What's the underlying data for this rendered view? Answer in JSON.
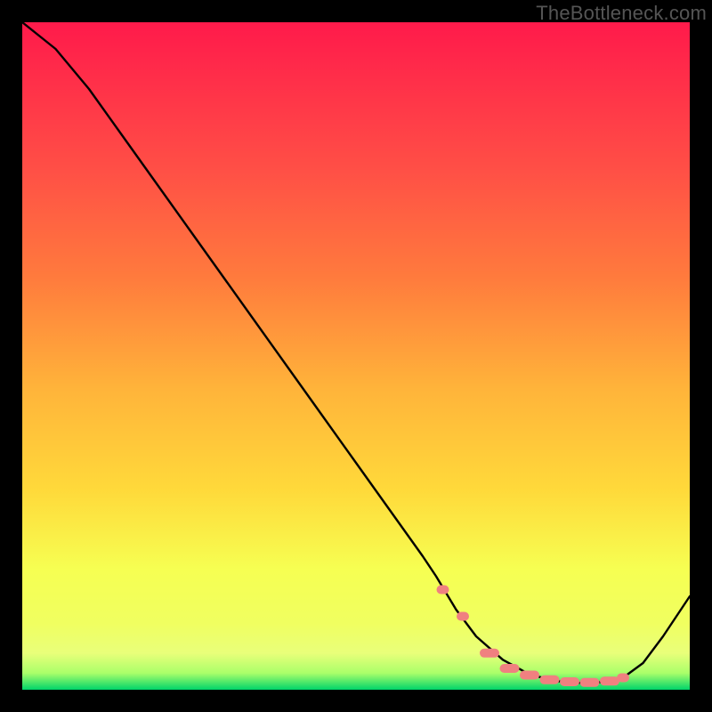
{
  "watermark": "TheBottleneck.com",
  "chart_data": {
    "type": "line",
    "title": "",
    "xlabel": "",
    "ylabel": "",
    "xlim": [
      0,
      100
    ],
    "ylim": [
      0,
      100
    ],
    "grid": false,
    "legend": false,
    "background_gradient": {
      "top": "#ff1a4b",
      "mid_upper": "#ff7a3d",
      "mid": "#ffd93a",
      "mid_lower": "#f6ff52",
      "optimal_band": "#e9ff7a",
      "bottom": "#00d46a"
    },
    "series": [
      {
        "name": "bottleneck-curve",
        "color": "#000000",
        "x": [
          0,
          5,
          10,
          15,
          20,
          25,
          30,
          35,
          40,
          45,
          50,
          55,
          60,
          62,
          65,
          68,
          72,
          76,
          80,
          84,
          88,
          90,
          93,
          96,
          100
        ],
        "y": [
          100,
          96,
          90,
          83,
          76,
          69,
          62,
          55,
          48,
          41,
          34,
          27,
          20,
          17,
          12,
          8,
          4.5,
          2.3,
          1.3,
          1.0,
          1.2,
          1.8,
          4,
          8,
          14
        ]
      }
    ],
    "markers": {
      "name": "highlight-dots",
      "color": "#f08080",
      "shape": "rounded",
      "x": [
        63,
        66,
        70,
        73,
        76,
        79,
        82,
        85,
        88,
        90
      ],
      "y": [
        15,
        11,
        5.5,
        3.2,
        2.2,
        1.5,
        1.2,
        1.1,
        1.3,
        1.8
      ]
    }
  }
}
